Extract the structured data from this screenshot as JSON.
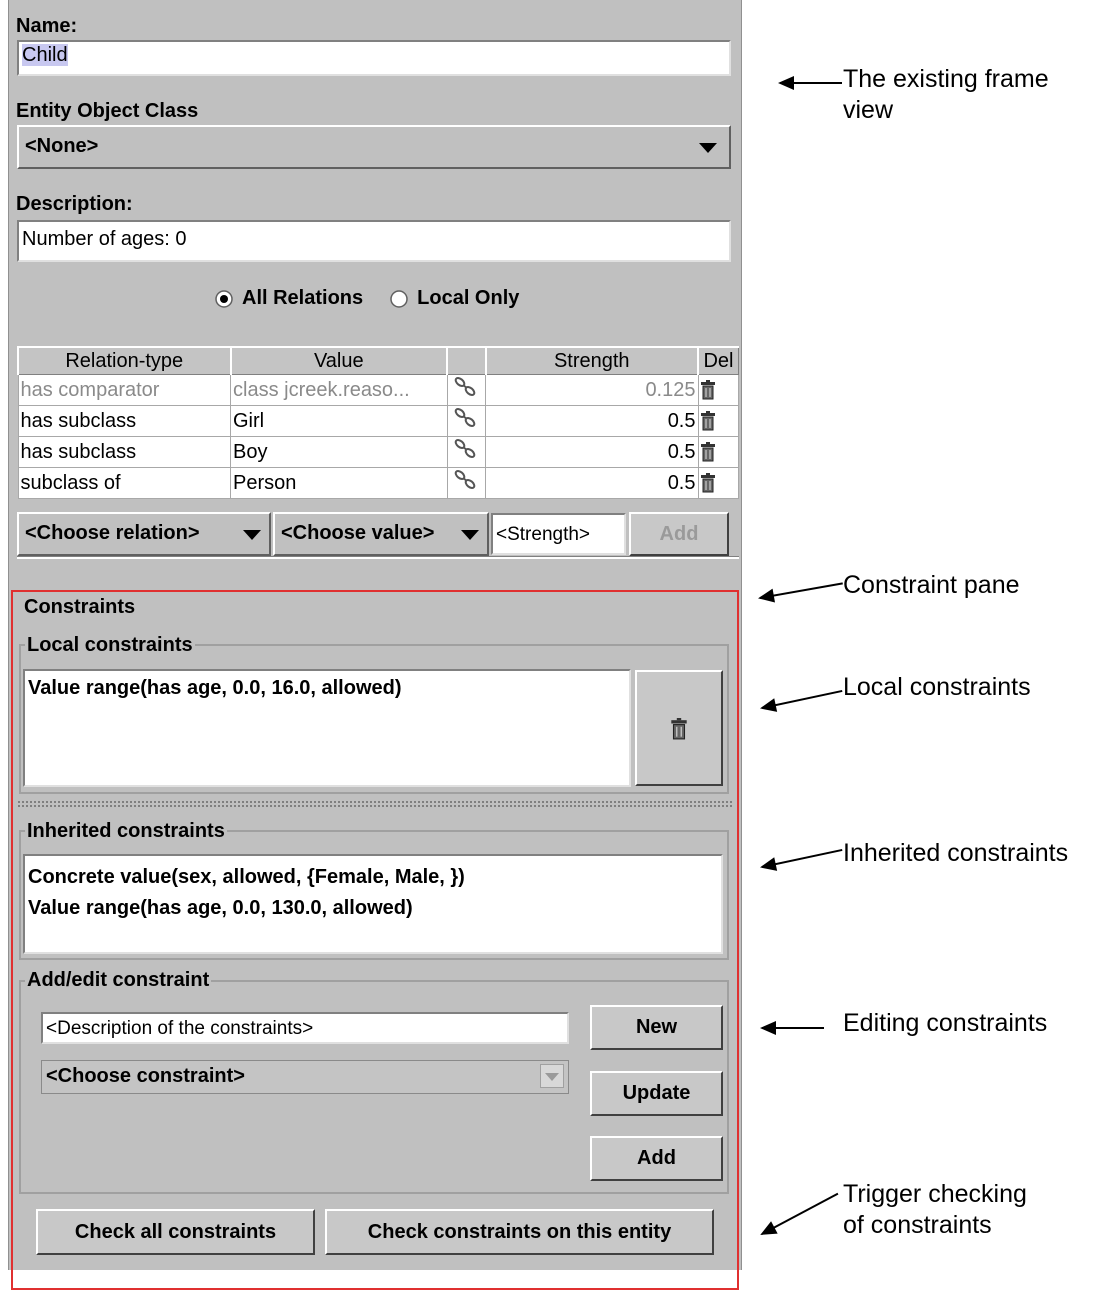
{
  "name": {
    "label": "Name:",
    "value": "Child"
  },
  "entity_class": {
    "label": "Entity Object Class",
    "value": "<None>"
  },
  "description": {
    "label": "Description:",
    "value": "Number of ages: 0"
  },
  "radio": {
    "all": "All Relations",
    "local": "Local Only",
    "selected": "all"
  },
  "table": {
    "headers": [
      "Relation-type",
      "Value",
      "",
      "Strength",
      "Del"
    ],
    "rows": [
      {
        "type": "has comparator",
        "value": "class jcreek.reaso...",
        "strength": "0.125",
        "dim": true
      },
      {
        "type": "has subclass",
        "value": "Girl",
        "strength": "0.5"
      },
      {
        "type": "has subclass",
        "value": "Boy",
        "strength": "0.5"
      },
      {
        "type": "subclass of",
        "value": "Person",
        "strength": "0.5"
      }
    ]
  },
  "relation_add": {
    "relation": "<Choose relation>",
    "value": "<Choose value>",
    "strength_placeholder": "<Strength>",
    "add": "Add"
  },
  "constraints": {
    "title": "Constraints",
    "local_title": "Local constraints",
    "local_items": [
      "Value range(has age, 0.0, 16.0, allowed)"
    ],
    "inherited_title": "Inherited constraints",
    "inherited_items": [
      "Concrete value(sex, allowed, {Female, Male, })",
      "Value range(has age, 0.0, 130.0, allowed)"
    ],
    "edit_title": "Add/edit constraint",
    "desc_placeholder": "<Description of the constraints>",
    "choose": "<Choose constraint>",
    "new": "New",
    "update": "Update",
    "add": "Add",
    "check_all": "Check all constraints",
    "check_entity": "Check constraints on this entity"
  },
  "annotations": {
    "frame": [
      "The existing frame",
      "view"
    ],
    "pane": "Constraint pane",
    "local": "Local constraints",
    "inherited": "Inherited constraints",
    "editing": "Editing constraints",
    "trigger": [
      "Trigger checking",
      "of constraints"
    ]
  },
  "colors": {
    "panel": "#c0c0c0",
    "constraint_border": "#e03030",
    "selection": "#c8c8f0"
  }
}
